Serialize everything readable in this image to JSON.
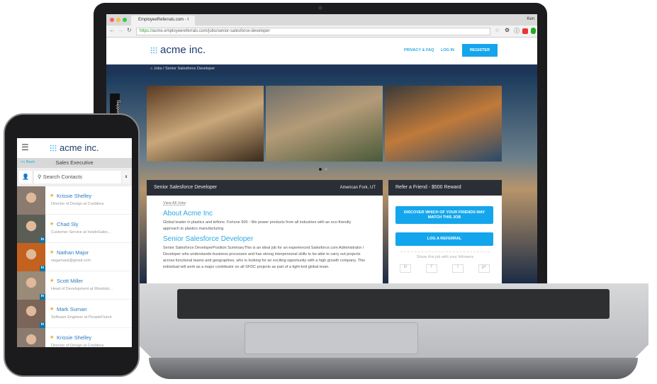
{
  "browser": {
    "tab_title": "EmployeeReferrals.com - I",
    "url_secure": "https://",
    "url_rest": "acme.employeereferrals.com/jobs/senior-salesforce-developer",
    "user": "Ken"
  },
  "site": {
    "logo": "acme inc.",
    "nav": [
      "PRIVACY & FAQ",
      "LOG IN"
    ],
    "register": "REGISTER",
    "breadcrumb": [
      "Jobs",
      "Senior Salesforce Developer"
    ],
    "support_tab": "Support"
  },
  "job": {
    "title": "Senior Salesforce Developer",
    "location": "American Fork, UT",
    "back": "View All Jobs",
    "about_heading": "About Acme Inc",
    "about_text": "Global leader in plastics and teflons.  Fortune 500 - We power products from all industries with an eco-friendly approach to plastics manufacturing.",
    "role_heading": "Senior Salesforce Developer",
    "role_text": "Senior Salesforce DeveloperPosition SummaryThis is an ideal job for an experienced Salesforce.com Administrator / Developer who understands business processes and has strong interpersonal skills to be able to carry out projects across functional teams and geographies, who is looking for an exciting opportunity with a high growth company. This individual will work as a major contributor on all SFDC projects as part of a tight-knit global team."
  },
  "refer": {
    "title": "Refer a Friend - $500 Reward",
    "discover": "DISCOVER WHICH OF YOUR FRIENDS MAY MATCH THIS JOB",
    "log": "LOG A REFERRAL",
    "share": "Share this job with your followers",
    "social": [
      "in",
      "f",
      "t",
      "g+"
    ]
  },
  "phone": {
    "logo": "acme inc.",
    "back": "<< Back",
    "title": "Sales Executive",
    "search_placeholder": "Search Contacts",
    "clear": "x",
    "contacts": [
      {
        "name": "Krissie Shelley",
        "title": "Director of Design at Creditera",
        "color": "#8a7a70"
      },
      {
        "name": "Chad Sly",
        "title": "Customer Service at InsideSales...",
        "color": "#5a5e54"
      },
      {
        "name": "Nathan Major",
        "title": "negamask@gmail.com",
        "color": "#c2621e"
      },
      {
        "name": "Scott Miller",
        "title": "Head of Development at Woodsto...",
        "color": "#9a8a78"
      },
      {
        "name": "Mark Suman",
        "title": "Software Engineer at PeopleFluent",
        "color": "#7a6558"
      },
      {
        "name": "Krissie Shelley",
        "title": "Director of Design at Creditera",
        "color": "#8a7a70"
      }
    ]
  }
}
